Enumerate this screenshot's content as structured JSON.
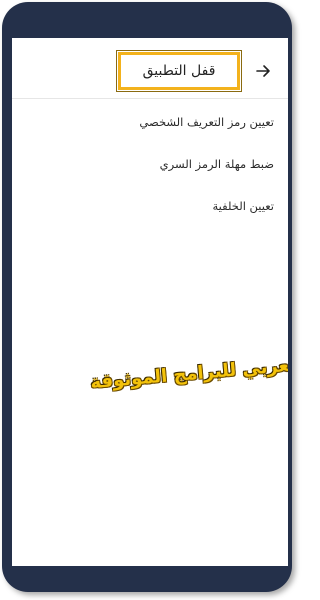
{
  "app_bar": {
    "title": "قفل التطبيق",
    "back_icon": "arrow-right-icon"
  },
  "menu": {
    "items": [
      {
        "label": "تعيين رمز التعريف الشخصي"
      },
      {
        "label": "ضبط مهلة الرمز السري"
      },
      {
        "label": "تعيين الخلفية"
      }
    ]
  },
  "watermark": {
    "text": "العربي للبرامج الموثوقة"
  },
  "colors": {
    "frame": "#24304a",
    "highlight": "#f3b21c",
    "watermark": "#f3c20a"
  }
}
